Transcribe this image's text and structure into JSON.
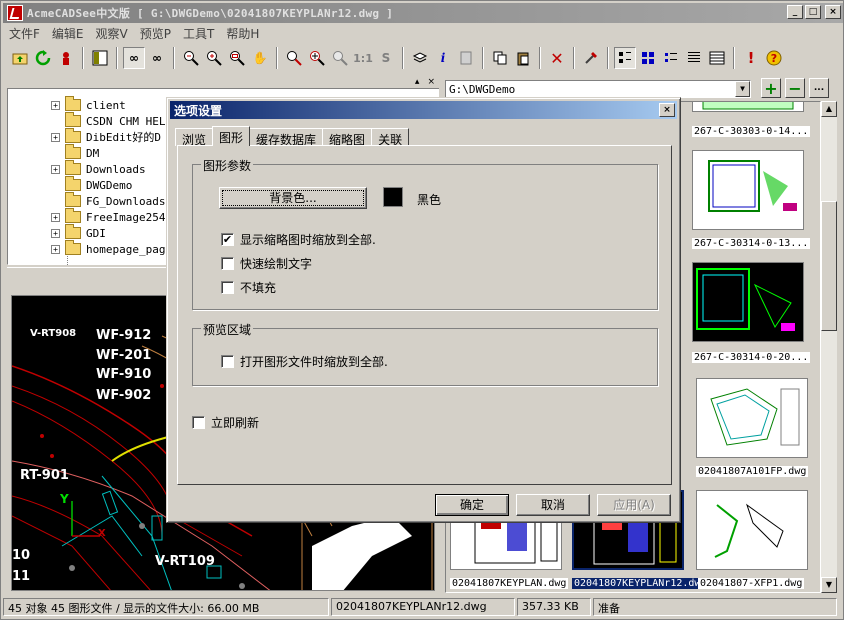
{
  "window": {
    "title": "AcmeCADSee中文版 [ G:\\DWGDemo\\02041807KEYPLANr12.dwg ]",
    "min": "_",
    "max": "□",
    "close": "×"
  },
  "menu": [
    "文件F",
    "编辑E",
    "观察V",
    "预览P",
    "工具T",
    "帮助H"
  ],
  "toolbar": {
    "btn_11": "1:1",
    "btn_s": "S"
  },
  "tree": {
    "items": [
      "client",
      "CSDN CHM HEL",
      "DibEdit好的D",
      "DM",
      "Downloads",
      "DWGDemo",
      "FG_Downloads",
      "FreeImage254",
      "GDI",
      "homepage_pag"
    ]
  },
  "cad": {
    "labels": [
      "V-RT908",
      "WF-912",
      "WF-201",
      "WF-910",
      "WF-902",
      "RT-901",
      "Y",
      "V-RT109",
      "10",
      "11",
      "X"
    ]
  },
  "right": {
    "path": "G:\\DWGDemo",
    "thumbs": [
      "267-C-30303-0-14...",
      "267-C-30314-0-13...",
      "267-C-30314-0-20...",
      "02041807A101FP.dwg",
      "02041807KEYPLAN.dwg",
      "02041807KEYPLANr12.dwg",
      "02041807-XFP1.dwg"
    ]
  },
  "status": {
    "objects": "45 对象 45 图形文件 / 显示的文件大小: 66.00 MB",
    "file": "02041807KEYPLANr12.dwg",
    "size": "357.33 KB",
    "state": "准备"
  },
  "dialog": {
    "title": "选项设置",
    "close": "×",
    "tabs": [
      "浏览",
      "图形",
      "缓存数据库",
      "缩略图",
      "关联"
    ],
    "group1_title": "图形参数",
    "bg_button": "背景色...",
    "bg_color_name": "黑色",
    "bg_color": "#000000",
    "opt1": "显示缩略图时缩放到全部.",
    "opt1_checked": "✔",
    "opt2": "快速绘制文字",
    "opt3": "不填充",
    "group2_title": "预览区域",
    "opt4": "打开图形文件时缩放到全部.",
    "opt5": "立即刷新",
    "ok": "确定",
    "cancel": "取消",
    "apply": "应用(A)"
  }
}
